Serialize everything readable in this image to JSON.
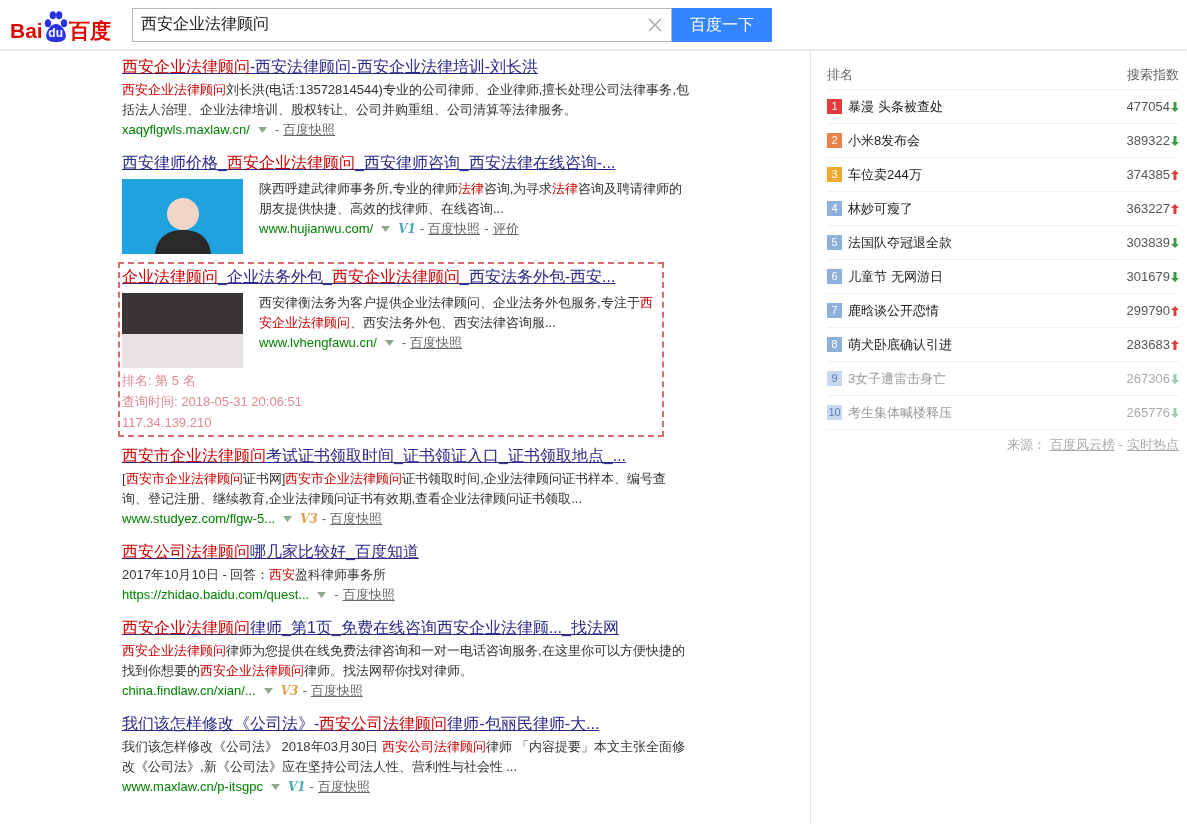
{
  "header": {
    "logo": [
      "Bai",
      "du",
      "百度"
    ],
    "search": {
      "value": "西安企业法律顾问"
    },
    "button": "百度一下"
  },
  "results": [
    {
      "kind": "text",
      "tracked": false,
      "title": [
        {
          "text": "西安企业法律顾问",
          "hl": true
        },
        {
          "text": "-西安法律顾问-西安企业法律培训-刘长洪",
          "hl": false
        }
      ],
      "snippet": [
        {
          "text": "西安企业法律顾问",
          "hl": true
        },
        {
          "text": "刘长洪(电话:13572814544)专业的公司律师、企业律师,擅长处理公司法律事务,包括法人治理、企业法律培训、股权转让、公司并购重组、公司清算等法律服务。",
          "hl": false
        }
      ],
      "url": "xaqyflgwls.maxlaw.cn/",
      "links": [
        "百度快照"
      ],
      "link_separator": "-"
    },
    {
      "kind": "portrait",
      "tracked": false,
      "title": [
        {
          "text": "西安律师价格_",
          "hl": false
        },
        {
          "text": "西安企业法律顾问",
          "hl": true
        },
        {
          "text": "_西安律师咨询_西安法律在线咨询-...",
          "hl": false
        }
      ],
      "snippet": [
        {
          "text": "陕西呼建武律师事务所,专业的律师",
          "hl": false
        },
        {
          "text": "法律",
          "hl": true
        },
        {
          "text": "咨询,为寻求",
          "hl": false
        },
        {
          "text": "法律",
          "hl": true
        },
        {
          "text": "咨询及聘请律师的朋友提供快捷、高效的找律师、在线咨询...",
          "hl": false
        }
      ],
      "url": "www.hujianwu.com/",
      "badge": {
        "text": "V1",
        "color": "#4aa8b8"
      },
      "links": [
        "百度快照",
        "评价"
      ],
      "link_separator": "-"
    },
    {
      "kind": "photo",
      "tracked": true,
      "title": [
        {
          "text": "企业法律顾问",
          "hl": true
        },
        {
          "text": "_企业法务外包_",
          "hl": false
        },
        {
          "text": "西安企业法律顾问",
          "hl": true
        },
        {
          "text": "_西安法务外包-西安...",
          "hl": false
        }
      ],
      "snippet": [
        {
          "text": "西安律衡法务为客户提供企业法律顾问、企业法务外包服务,专注于",
          "hl": false
        },
        {
          "text": "西安企业法律顾问",
          "hl": true
        },
        {
          "text": "、西安法务外包、西安法律咨询服...",
          "hl": false
        }
      ],
      "url": "www.lvhengfawu.cn/",
      "links": [
        "百度快照"
      ],
      "link_separator": "-",
      "rank_info": [
        "排名: 第 5 名",
        "查询时间: 2018-05-31 20:06:51",
        "117.34.139.210"
      ]
    },
    {
      "kind": "text",
      "tracked": false,
      "title": [
        {
          "text": "西安市企业法律顾问",
          "hl": true
        },
        {
          "text": "考试证书领取时间_证书领证入口_证书领取地点_...",
          "hl": false
        }
      ],
      "snippet": [
        {
          "text": "[",
          "hl": false
        },
        {
          "text": "西安市企业法律顾问",
          "hl": true
        },
        {
          "text": "证书网]",
          "hl": false
        },
        {
          "text": "西安市企业法律顾问",
          "hl": true
        },
        {
          "text": "证书领取时间,企业法律顾问证书样本、编号查询、登记注册、继续教育,企业法律顾问证书有效期,查看企业法律顾问证书领取...",
          "hl": false
        }
      ],
      "url": "www.studyez.com/flgw-5...",
      "badge": {
        "text": "V3",
        "color": "#e0a050"
      },
      "links": [
        "百度快照"
      ],
      "link_separator": "-"
    },
    {
      "kind": "text",
      "tracked": false,
      "title": [
        {
          "text": "西安公司法律顾问",
          "hl": true
        },
        {
          "text": "哪几家比较好_百度知道",
          "hl": false
        }
      ],
      "snippet": [
        {
          "text": "2017年10月10日 - 回答：",
          "hl": false
        },
        {
          "text": "西安",
          "hl": true
        },
        {
          "text": "盈科律师事务所",
          "hl": false
        }
      ],
      "url": "https://zhidao.baidu.com/quest...",
      "links": [
        "百度快照"
      ],
      "link_separator": "-"
    },
    {
      "kind": "text",
      "tracked": false,
      "title": [
        {
          "text": "西安企业法律顾问",
          "hl": true
        },
        {
          "text": "律师_第1页_免费在线咨询西安企业法律顾..._找法网",
          "hl": false
        }
      ],
      "snippet": [
        {
          "text": "西安企业法律顾问",
          "hl": true
        },
        {
          "text": "律师为您提供在线免费法律咨询和一对一电话咨询服务,在这里你可以方便快捷的找到你想要的",
          "hl": false
        },
        {
          "text": "西安企业法律顾问",
          "hl": true
        },
        {
          "text": "律师。找法网帮你找对律师。",
          "hl": false
        }
      ],
      "url": "china.findlaw.cn/xian/...",
      "badge": {
        "text": "V3",
        "color": "#e0a050"
      },
      "links": [
        "百度快照"
      ],
      "link_separator": "-"
    },
    {
      "kind": "text",
      "tracked": false,
      "title": [
        {
          "text": "我们该怎样修改《公司法》-",
          "hl": false
        },
        {
          "text": "西安公司法律顾问",
          "hl": true
        },
        {
          "text": "律师-包丽民律师-大...",
          "hl": false
        }
      ],
      "snippet": [
        {
          "text": "我们该怎样修改《公司法》 2018年03月30日 ",
          "hl": false
        },
        {
          "text": "西安公司法律顾问",
          "hl": true
        },
        {
          "text": "律师 「内容提要」本文主张全面修改《公司法》,新《公司法》应在坚持公司法人性、营利性与社会性 ...",
          "hl": false
        }
      ],
      "url": "www.maxlaw.cn/p-itsgpc",
      "badge": {
        "text": "V1",
        "color": "#4aa8b8"
      },
      "links": [
        "百度快照"
      ],
      "link_separator": "-"
    }
  ],
  "hot_list": {
    "columns": [
      "排名",
      "搜索指数"
    ],
    "rows": [
      {
        "rank": "1",
        "title": "暴漫 头条被查处",
        "index": "477054",
        "kind": "falling",
        "color": "#e43c3c",
        "faded": false
      },
      {
        "rank": "2",
        "title": "小米8发布会",
        "index": "389322",
        "kind": "falling",
        "color": "#e8844a",
        "faded": false
      },
      {
        "rank": "3",
        "title": "车位卖244万",
        "index": "374385",
        "kind": "rising",
        "color": "#f0a830",
        "faded": false
      },
      {
        "rank": "4",
        "title": "林妙可瘦了",
        "index": "363227",
        "kind": "rising",
        "color": "#8eb0dc",
        "faded": false
      },
      {
        "rank": "5",
        "title": "法国队夺冠退全款",
        "index": "303839",
        "kind": "falling",
        "color": "#8eb0dc",
        "faded": false
      },
      {
        "rank": "6",
        "title": "儿童节 无网游日",
        "index": "301679",
        "kind": "falling",
        "color": "#8eb0dc",
        "faded": false
      },
      {
        "rank": "7",
        "title": "鹿晗谈公开恋情",
        "index": "299790",
        "kind": "rising",
        "color": "#8eb0dc",
        "faded": false
      },
      {
        "rank": "8",
        "title": "萌犬卧底确认引进",
        "index": "283683",
        "kind": "rising",
        "color": "#8eb0dc",
        "faded": false
      },
      {
        "rank": "9",
        "title": "3女子遭雷击身亡",
        "index": "267306",
        "kind": "falling",
        "color": "#c9d8ee",
        "faded": true
      },
      {
        "rank": "10",
        "title": "考生集体喊楼释压",
        "index": "265776",
        "kind": "falling",
        "color": "#c9d8ee",
        "faded": true
      }
    ],
    "source": {
      "label": "来源：",
      "links": [
        "百度风云榜",
        "实时热点"
      ],
      "separator": "-"
    }
  }
}
